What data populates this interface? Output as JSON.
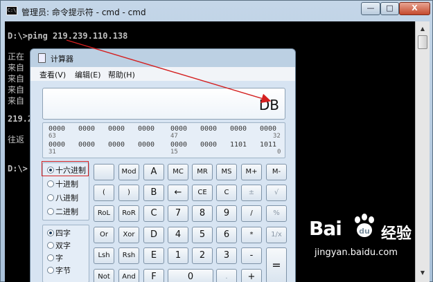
{
  "cmd": {
    "title": "管理员: 命令提示符 - cmd - cmd",
    "icon_text": "C:\\",
    "min_glyph": "—",
    "max_glyph": "□",
    "close_glyph": "X",
    "lines": [
      "D:\\>ping 219.239.110.138",
      "正在",
      "来自",
      "来自",
      "来自",
      "来自",
      "219.2",
      "往返",
      "D:\\>"
    ]
  },
  "calc": {
    "title": "计算器",
    "menus": [
      "查看(V)",
      "编辑(E)",
      "帮助(H)"
    ],
    "display": "DB",
    "bits": {
      "row1": [
        "0000",
        "0000",
        "0000",
        "0000",
        "0000",
        "0000",
        "0000",
        "0000"
      ],
      "row1_pos": [
        "63",
        "47",
        "32"
      ],
      "row2": [
        "0000",
        "0000",
        "0000",
        "0000",
        "0000",
        "0000",
        "1101",
        "1011"
      ],
      "row2_pos": [
        "31",
        "15",
        "0"
      ]
    },
    "modes": [
      "十六进制",
      "十进制",
      "八进制",
      "二进制"
    ],
    "words": [
      "四字",
      "双字",
      "字",
      "字节"
    ],
    "buttons": {
      "r1": [
        "",
        "Mod",
        "A",
        "MC",
        "MR",
        "MS",
        "M+",
        "M-"
      ],
      "r2": [
        "(",
        ")",
        "B",
        "←",
        "CE",
        "C",
        "±",
        "√"
      ],
      "r3": [
        "RoL",
        "RoR",
        "C",
        "7",
        "8",
        "9",
        "/",
        "%"
      ],
      "r4": [
        "Or",
        "Xor",
        "D",
        "4",
        "5",
        "6",
        "*",
        "1/x"
      ],
      "r5": [
        "Lsh",
        "Rsh",
        "E",
        "1",
        "2",
        "3",
        "-",
        "="
      ],
      "r6": [
        "Not",
        "And",
        "F",
        "0",
        ".",
        "+"
      ]
    }
  },
  "watermark": {
    "logo": "Bai",
    "logo_du": "du",
    "cn": "经验",
    "url": "jingyan.baidu.com"
  },
  "colors": {
    "annotation": "#d42020",
    "console_bg": "#000000"
  }
}
